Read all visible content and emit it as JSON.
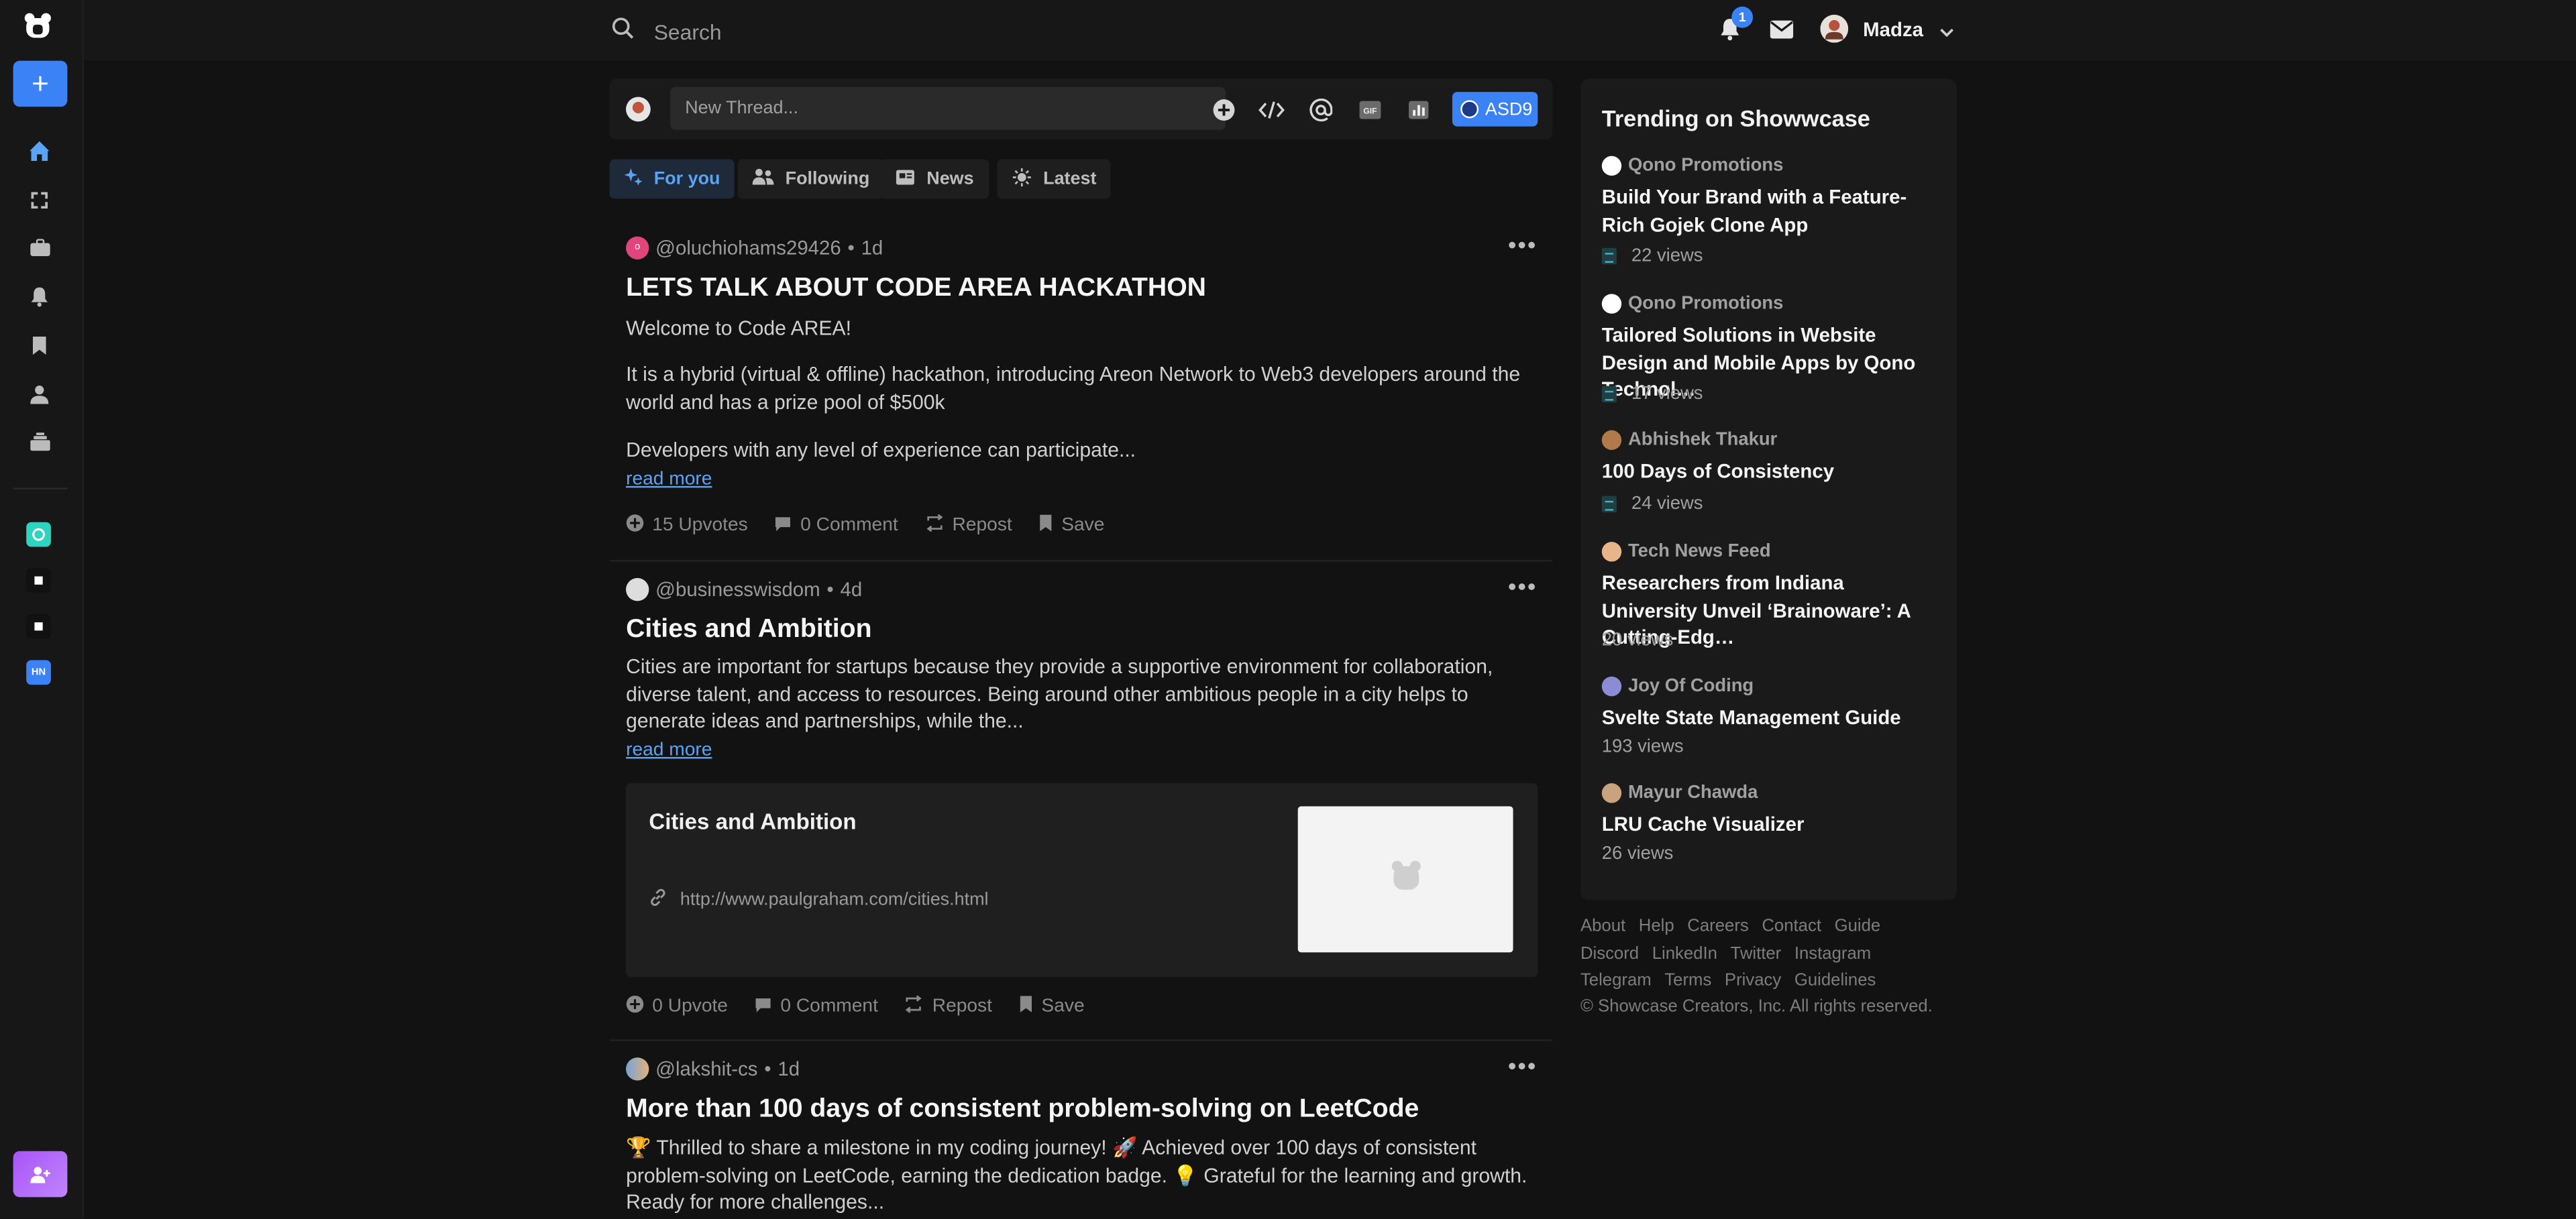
{
  "topbar": {
    "search_placeholder": "Search",
    "notification_count": "1",
    "user_name": "Madza"
  },
  "composer": {
    "placeholder": "New Thread...",
    "badge_label": "ASD9"
  },
  "tabs": [
    {
      "label": "For you",
      "icon": "sparkle-icon"
    },
    {
      "label": "Following",
      "icon": "people-icon"
    },
    {
      "label": "News",
      "icon": "news-icon"
    },
    {
      "label": "Latest",
      "icon": "sun-icon"
    }
  ],
  "posts": [
    {
      "author": "@oluchiohams29426",
      "age": "1d",
      "title": "LETS TALK ABOUT CODE AREA HACKATHON",
      "paragraphs": [
        "Welcome to Code AREA!",
        "It is a hybrid (virtual & offline) hackathon, introducing Areon Network to Web3 developers around the world and has a prize pool of $500k",
        "Developers with any level of experience can participate..."
      ],
      "read_more": "read more",
      "upvotes": "15 Upvotes",
      "comments": "0 Comment",
      "repost": "Repost",
      "save": "Save"
    },
    {
      "author": "@businesswisdom",
      "age": "4d",
      "title": "Cities and Ambition",
      "paragraphs": [
        "Cities are important for startups because they provide a supportive environment for collaboration, diverse talent, and access to resources. Being around other ambitious people in a city helps to generate ideas and partnerships, while the..."
      ],
      "read_more": "read more",
      "link_card": {
        "title": "Cities and Ambition",
        "url": "http://www.paulgraham.com/cities.html"
      },
      "upvotes": "0 Upvote",
      "comments": "0 Comment",
      "repost": "Repost",
      "save": "Save"
    },
    {
      "author": "@lakshit-cs",
      "age": "1d",
      "title": "More than 100 days of consistent problem-solving on LeetCode",
      "paragraphs": [
        "🏆 Thrilled to share a milestone in my coding journey! 🚀 Achieved over 100 days of consistent problem-solving on LeetCode, earning the dedication badge. 💡 Grateful for the learning and growth. Ready for more challenges..."
      ]
    }
  ],
  "trending": {
    "heading": "Trending on Showwcase",
    "items": [
      {
        "author": "Qono Promotions",
        "title": "Build Your Brand with a Feature-Rich Gojek Clone App",
        "views": "22 views",
        "doc": true
      },
      {
        "author": "Qono Promotions",
        "title": "Tailored Solutions in Website Design and Mobile Apps by Qono Technol…",
        "views": "17 views",
        "doc": true
      },
      {
        "author": "Abhishek Thakur",
        "title": "100 Days of Consistency",
        "views": "24 views",
        "doc": true
      },
      {
        "author": "Tech News Feed",
        "title": "Researchers from Indiana University Unveil ‘Brainoware’: A Cutting-Edg…",
        "views": "20 views",
        "doc": false
      },
      {
        "author": "Joy Of Coding",
        "title": "Svelte State Management Guide",
        "views": "193 views",
        "doc": false
      },
      {
        "author": "Mayur Chawda",
        "title": "LRU Cache Visualizer",
        "views": "26 views",
        "doc": false
      }
    ]
  },
  "footer": {
    "row1": [
      "About",
      "Help",
      "Careers",
      "Contact",
      "Guide"
    ],
    "row2": [
      "Discord",
      "LinkedIn",
      "Twitter",
      "Instagram"
    ],
    "row3": [
      "Telegram",
      "Terms",
      "Privacy",
      "Guidelines"
    ],
    "copyright": "© Showcase Creators, Inc. All rights reserved."
  },
  "sidebar": {
    "app_hn_label": "HN"
  },
  "colors": {
    "accent": "#3b82f6",
    "background": "#121212",
    "panel": "#1a1a1a"
  }
}
